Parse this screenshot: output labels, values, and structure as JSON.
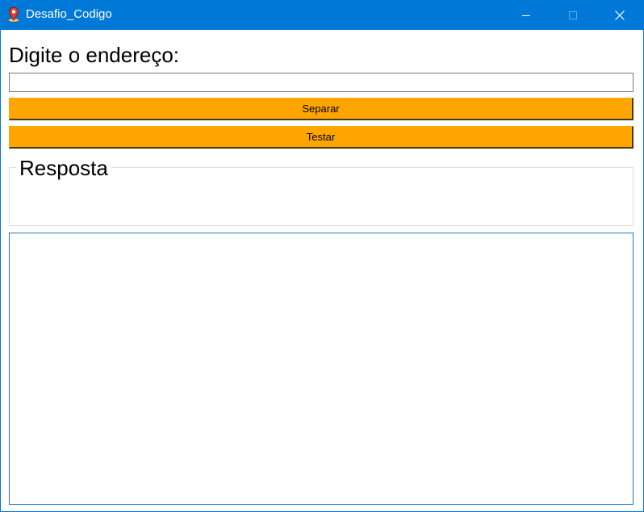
{
  "window": {
    "title": "Desafio_Codigo",
    "icon": "map-pin-icon",
    "controls": [
      "minimize-icon",
      "maximize-icon",
      "close-icon"
    ],
    "titlebar_color": "#0078d7"
  },
  "form": {
    "address_label": "Digite o endereço:",
    "address_value": "",
    "separar_label": "Separar",
    "testar_label": "Testar",
    "button_color": "#ffa500"
  },
  "response": {
    "group_title": "Resposta",
    "output_value": ""
  }
}
